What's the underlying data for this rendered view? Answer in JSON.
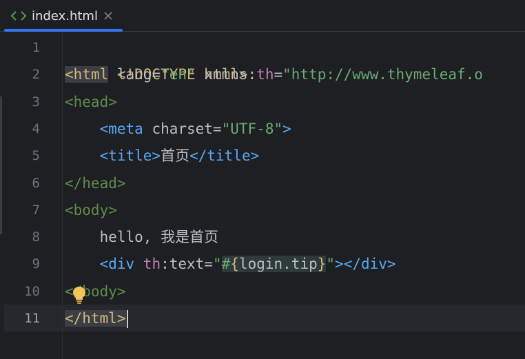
{
  "tab": {
    "label": "index.html",
    "icon": "html-file-icon",
    "close_icon": "close-icon",
    "accent": "#3574f0"
  },
  "gutter": {
    "line_numbers": [
      "1",
      "2",
      "3",
      "4",
      "5",
      "6",
      "7",
      "8",
      "9",
      "10",
      "11"
    ],
    "current_line": "11"
  },
  "code": {
    "line1": {
      "decl": "<!DOCTYPE html>"
    },
    "line2": {
      "open": "<",
      "tag": "html",
      "attr1_name": " lang",
      "eq1": "=",
      "attr1_val": "\"en\"",
      "attr2_ns": " xmlns:",
      "attr2_name": "th",
      "eq2": "=",
      "attr2_val": "\"http://www.thymeleaf.o"
    },
    "line3": {
      "tag": "<head>"
    },
    "line4": {
      "indent": "    ",
      "open": "<meta",
      "attr_name": " charset",
      "eq": "=",
      "attr_val": "\"UTF-8\"",
      "close": ">"
    },
    "line5": {
      "indent": "    ",
      "open": "<title>",
      "text": "首页",
      "close": "</title>"
    },
    "line6": {
      "tag": "</head>"
    },
    "line7": {
      "tag": "<body>"
    },
    "line8": {
      "indent": "    ",
      "text": "hello, 我是首页"
    },
    "line9": {
      "indent": "    ",
      "open": "<div",
      "ns": " th",
      "colon_attr": ":text",
      "eq": "=",
      "q1": "\"",
      "hash": "#",
      "lbrace": "{",
      "expr": "login.tip",
      "rbrace": "}",
      "q2": "\"",
      "gt": ">",
      "close": "</div>"
    },
    "line10": {
      "lt": "<",
      "tag": "/body>"
    },
    "line11": {
      "tag": "</html>"
    }
  },
  "colors": {
    "background": "#1e1f22",
    "tag": "#56a8f5",
    "string": "#6aab73",
    "doctype": "#d5b778",
    "namespace": "#c77dbb",
    "text": "#bcbec4"
  },
  "icons": {
    "intention": "lightbulb-icon"
  }
}
